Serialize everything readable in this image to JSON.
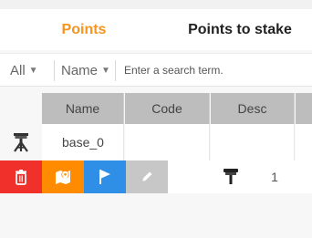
{
  "tabs": [
    {
      "label": "Points",
      "active": true
    },
    {
      "label": "Points to stake",
      "active": false
    }
  ],
  "search": {
    "filter_scope": "All",
    "filter_field": "Name",
    "placeholder": "Enter a search term.",
    "value": ""
  },
  "table": {
    "columns": [
      "Name",
      "Code",
      "Desc",
      ""
    ],
    "rows": [
      {
        "type_icon": "base-station-icon",
        "name": "base_0",
        "code": "",
        "desc": ""
      }
    ]
  },
  "action_bar": {
    "buttons": [
      {
        "icon": "trash-icon",
        "color": "#f0302b"
      },
      {
        "icon": "map-pin-icon",
        "color": "#ff8c00"
      },
      {
        "icon": "flag-icon",
        "color": "#2f8fe6"
      },
      {
        "icon": "pencil-icon",
        "color": "#c7c7c7"
      }
    ],
    "antenna_icon": "antenna-icon",
    "count": "1"
  },
  "colors": {
    "accent": "#f7941d",
    "header_bg": "#bdbdbd"
  }
}
